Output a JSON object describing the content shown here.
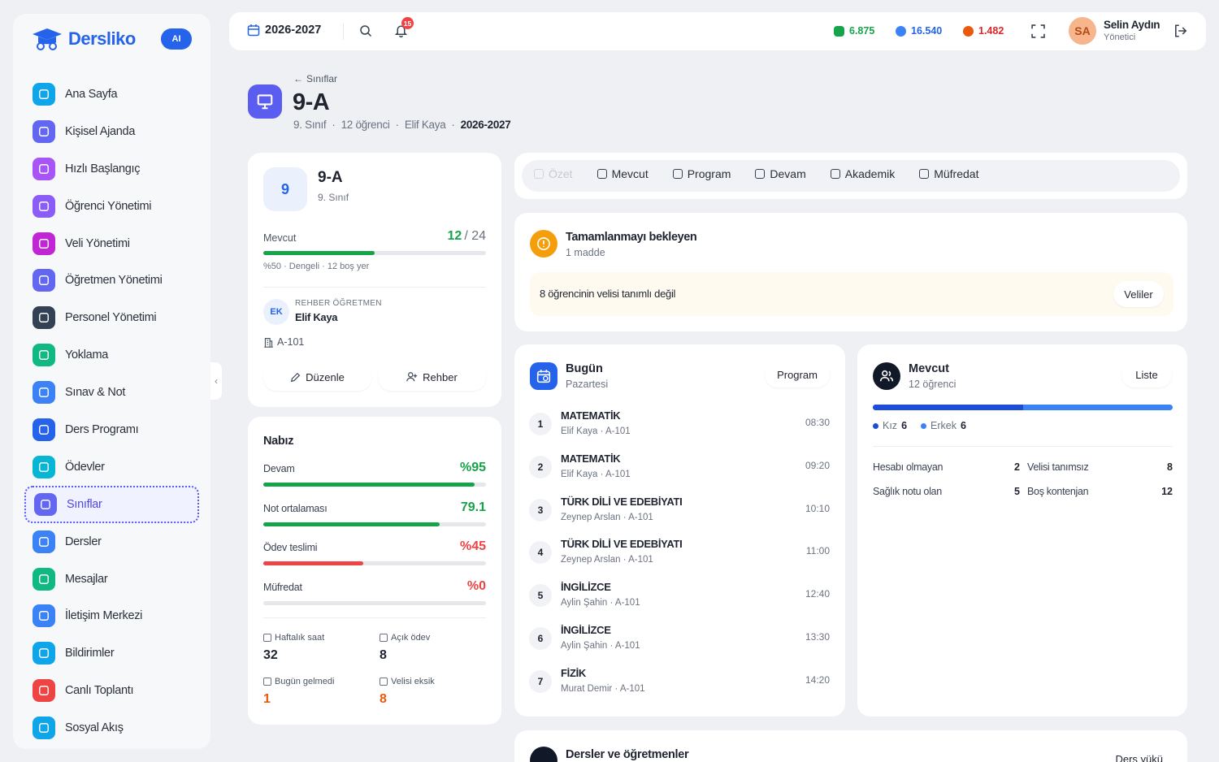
{
  "app": {
    "name": "Dersliko",
    "ai_label": "AI"
  },
  "sidebar": {
    "items": [
      {
        "label": "Ana Sayfa",
        "icon": "home-icon",
        "color": "#0ea5e9"
      },
      {
        "label": "Kişisel Ajanda",
        "icon": "calendar-icon",
        "color": "#6366f1"
      },
      {
        "label": "Hızlı Başlangıç",
        "icon": "play-icon",
        "color": "#a855f7"
      },
      {
        "label": "Öğrenci Yönetimi",
        "icon": "users-icon",
        "color": "#8b5cf6"
      },
      {
        "label": "Veli Yönetimi",
        "icon": "users-icon",
        "color": "#c026d3"
      },
      {
        "label": "Öğretmen Yönetimi",
        "icon": "teacher-icon",
        "color": "#6366f1"
      },
      {
        "label": "Personel Yönetimi",
        "icon": "id-card-icon",
        "color": "#334155"
      },
      {
        "label": "Yoklama",
        "icon": "clipboard-check-icon",
        "color": "#10b981"
      },
      {
        "label": "Sınav & Not",
        "icon": "exam-icon",
        "color": "#3b82f6"
      },
      {
        "label": "Ders Programı",
        "icon": "calendar-clock-icon",
        "color": "#2563eb"
      },
      {
        "label": "Ödevler",
        "icon": "clipboard-icon",
        "color": "#06b6d4"
      },
      {
        "label": "Sınıflar",
        "icon": "presentation-icon",
        "color": "#6366f1",
        "active": true
      },
      {
        "label": "Dersler",
        "icon": "book-icon",
        "color": "#3b82f6"
      },
      {
        "label": "Mesajlar",
        "icon": "message-icon",
        "color": "#10b981"
      },
      {
        "label": "İletişim Merkezi",
        "icon": "megaphone-icon",
        "color": "#3b82f6"
      },
      {
        "label": "Bildirimler",
        "icon": "bell-icon",
        "color": "#0ea5e9"
      },
      {
        "label": "Canlı Toplantı",
        "icon": "broadcast-icon",
        "color": "#ef4444"
      },
      {
        "label": "Sosyal Akış",
        "icon": "rss-icon",
        "color": "#0ea5e9"
      }
    ]
  },
  "topbar": {
    "year": "2026-2027",
    "notif_count": "15",
    "stat_green": "6.875",
    "stat_blue": "16.540",
    "stat_red": "1.482",
    "user_initials": "SA",
    "user_name": "Selin Aydın",
    "user_role": "Yönetici"
  },
  "header": {
    "back": "Sınıflar",
    "title": "9-A",
    "grade": "9. Sınıf",
    "students": "12 öğrenci",
    "teacher": "Elif Kaya",
    "year": "2026-2027"
  },
  "summary": {
    "badge": "9",
    "title": "9-A",
    "subtitle": "9. Sınıf",
    "current_label": "Mevcut",
    "current": "12",
    "capacity": "/ 24",
    "fill": 0.5,
    "fill_text": "%50 · Dengeli · 12 boş yer",
    "teacher_initials": "EK",
    "teacher_role": "REHBER ÖĞRETMEN",
    "teacher_name": "Elif Kaya",
    "room": "A-101",
    "edit": "Düzenle",
    "guide": "Rehber"
  },
  "pulse": {
    "title": "Nabız",
    "metrics": [
      {
        "label": "Devam",
        "value": "%95",
        "fill": 0.95,
        "color": "#16a34a"
      },
      {
        "label": "Not ortalaması",
        "value": "79.1",
        "fill": 0.791,
        "color": "#16a34a"
      },
      {
        "label": "Ödev teslimi",
        "value": "%45",
        "fill": 0.45,
        "color": "#ef4444"
      },
      {
        "label": "Müfredat",
        "value": "%0",
        "fill": 0,
        "color": "#ef4444"
      }
    ],
    "stats": [
      {
        "label": "Haftalık saat",
        "value": "32",
        "icon": "calendar-icon"
      },
      {
        "label": "Açık ödev",
        "value": "8",
        "icon": "book-icon"
      },
      {
        "label": "Bugün gelmedi",
        "value": "1",
        "icon": "users-icon"
      },
      {
        "label": "Velisi eksik",
        "value": "8",
        "icon": "users-icon"
      }
    ]
  },
  "tabs": [
    {
      "label": "Özet",
      "icon": "sparkle-icon"
    },
    {
      "label": "Mevcut",
      "icon": "users-icon"
    },
    {
      "label": "Program",
      "icon": "calendar-clock-icon"
    },
    {
      "label": "Devam",
      "icon": "calendar-icon"
    },
    {
      "label": "Akademik",
      "icon": "graduation-icon"
    },
    {
      "label": "Müfredat",
      "icon": "target-icon"
    }
  ],
  "pending": {
    "title": "Tamamlanmayı bekleyen",
    "count": "1 madde",
    "item": "8 öğrencinin velisi tanımlı değil",
    "action": "Veliler"
  },
  "today": {
    "title": "Bugün",
    "day": "Pazartesi",
    "action": "Program",
    "lessons": [
      {
        "n": "1",
        "subject": "MATEMATİK",
        "teacher": "Elif Kaya · A-101",
        "time": "08:30"
      },
      {
        "n": "2",
        "subject": "MATEMATİK",
        "teacher": "Elif Kaya · A-101",
        "time": "09:20"
      },
      {
        "n": "3",
        "subject": "TÜRK DİLİ VE EDEBİYATI",
        "teacher": "Zeynep Arslan · A-101",
        "time": "10:10"
      },
      {
        "n": "4",
        "subject": "TÜRK DİLİ VE EDEBİYATI",
        "teacher": "Zeynep Arslan · A-101",
        "time": "11:00"
      },
      {
        "n": "5",
        "subject": "İNGİLİZCE",
        "teacher": "Aylin Şahin · A-101",
        "time": "12:40"
      },
      {
        "n": "6",
        "subject": "İNGİLİZCE",
        "teacher": "Aylin Şahin · A-101",
        "time": "13:30"
      },
      {
        "n": "7",
        "subject": "FİZİK",
        "teacher": "Murat Demir · A-101",
        "time": "14:20"
      }
    ]
  },
  "enrollment": {
    "title": "Mevcut",
    "count": "12 öğrenci",
    "action": "Liste",
    "girls_label": "Kız",
    "girls": "6",
    "boys_label": "Erkek",
    "boys": "6",
    "girls_fraction": 0.5,
    "stats": [
      {
        "label": "Hesabı olmayan",
        "value": "2"
      },
      {
        "label": "Velisi tanımsız",
        "value": "8"
      },
      {
        "label": "Sağlık notu olan",
        "value": "5"
      },
      {
        "label": "Boş kontenjan",
        "value": "12"
      }
    ]
  },
  "lessons_card": {
    "title": "Dersler ve öğretmenler",
    "action": "Ders yükü"
  }
}
